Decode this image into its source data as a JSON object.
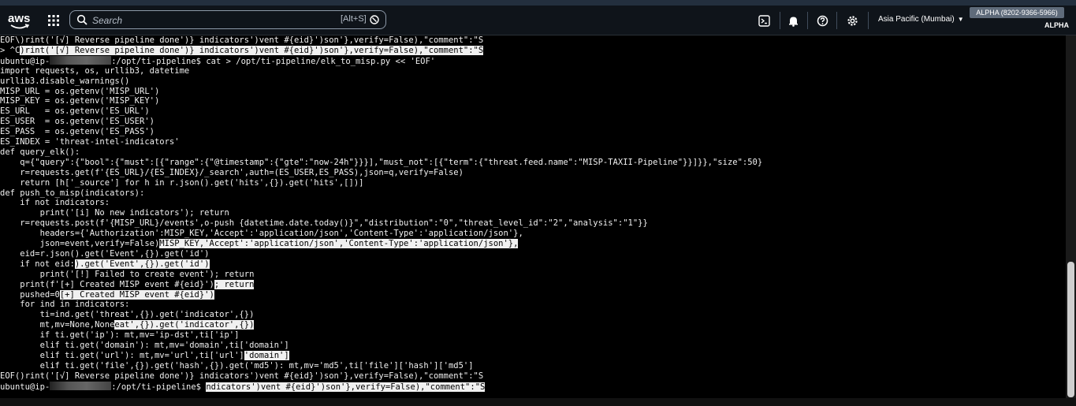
{
  "navbar": {
    "logo_text": "aws",
    "search": {
      "placeholder": "Search",
      "shortcut": "[Alt+S]"
    },
    "region": "Asia Pacific (Mumbai)",
    "account": "ALPHA (8202-9366-5966)",
    "account_sub": "ALPHA",
    "icons": [
      "grid-icon",
      "search-icon",
      "clear-icon",
      "cloudshell-icon",
      "bell-icon",
      "help-icon",
      "gear-icon"
    ]
  },
  "colors": {
    "navbar_bg": "#0f141a",
    "terminal_bg": "#000000",
    "text": "#f0f0f0"
  },
  "terminal": {
    "lines": [
      {
        "text": "EOF\\)rint('[√] Reverse pipeline done')} indicators')vent #{eid}')son'},verify=False),\"comment\":\"S"
      },
      {
        "text": "> ^C",
        "hl": ")rint('[√] Reverse pipeline done')} indicators')vent #{eid}')son'},verify=False),\"comment\":\"S"
      },
      {
        "text": "ubuntu@ip-",
        "redact": true,
        "text2": ":/opt/ti-pipeline$ cat > /opt/ti-pipeline/elk_to_misp.py << 'EOF'"
      },
      {
        "text": "import requests, os, urllib3, datetime"
      },
      {
        "text": "urllib3.disable_warnings()"
      },
      {
        "text": "MISP_URL = os.getenv('MISP_URL')"
      },
      {
        "text": "MISP_KEY = os.getenv('MISP_KEY')"
      },
      {
        "text": "ES_URL   = os.getenv('ES_URL')"
      },
      {
        "text": "ES_USER  = os.getenv('ES_USER')"
      },
      {
        "text": "ES_PASS  = os.getenv('ES_PASS')"
      },
      {
        "text": "ES_INDEX = 'threat-intel-indicators'"
      },
      {
        "text": "def query_elk():"
      },
      {
        "text": "    q={\"query\":{\"bool\":{\"must\":[{\"range\":{\"@timestamp\":{\"gte\":\"now-24h\"}}}],\"must_not\":[{\"term\":{\"threat.feed.name\":\"MISP-TAXII-Pipeline\"}}]}},\"size\":50}"
      },
      {
        "text": "    r=requests.get(f'{ES_URL}/{ES_INDEX}/_search',auth=(ES_USER,ES_PASS),json=q,verify=False)"
      },
      {
        "text": "    return [h['_source'] for h in r.json().get('hits',{}).get('hits',[])]"
      },
      {
        "text": "def push_to_misp(indicators):"
      },
      {
        "text": "    if not indicators:"
      },
      {
        "text": "        print('[i] No new indicators'); return"
      },
      {
        "text": "    r=requests.post(f'{MISP_URL}/events',o-push {datetime.date.today()}\",\"distribution\":\"0\",\"threat_level_id\":\"2\",\"analysis\":\"1\"}}"
      },
      {
        "text": "        headers={'Authorization':MISP_KEY,'Accept':'application/json','Content-Type':'application/json'},"
      },
      {
        "text": "        json=event,verify=False)",
        "hl": "MISP_KEY,'Accept':'application/json','Content-Type':'application/json'},"
      },
      {
        "text": "    eid=r.json().get('Event',{}).get('id')"
      },
      {
        "text": "    if not eid:",
        "hl": ").get('Event',{}).get('id')"
      },
      {
        "text": "        print('[!] Failed to create event'); return"
      },
      {
        "text": "    print(f'[+] Created MISP event #{eid}')",
        "hl": "; return"
      },
      {
        "text": "    pushed=0",
        "hl": "[+] Created MISP event #{eid}')"
      },
      {
        "text": "    for ind in indicators:"
      },
      {
        "text": "        ti=ind.get('threat',{}).get('indicator',{})"
      },
      {
        "text": "        mt,mv=None,None",
        "hl": "eat',{}).get('indicator',{})"
      },
      {
        "text": "        if ti.get('ip'): mt,mv='ip-dst',ti['ip']"
      },
      {
        "text": "        elif ti.get('domain'): mt,mv='domain',ti['domain']"
      },
      {
        "text": "        elif ti.get('url'): mt,mv='url',ti['url']",
        "hl": "'domain']"
      },
      {
        "text": "        elif ti.get('file',{}).get('hash',{}).get('md5'): mt,mv='md5',ti['file']['hash']['md5']"
      },
      {
        "text": "EOF()rint('[√] Reverse pipeline done')} indicators')vent #{eid}')son'},verify=False),\"comment\":\"S"
      },
      {
        "text": "ubuntu@ip-",
        "redact": true,
        "text2": ":/opt/ti-pipeline$ ",
        "hl": "ndicators')vent #{eid}')son'},verify=False),\"comment\":\"S"
      }
    ]
  }
}
